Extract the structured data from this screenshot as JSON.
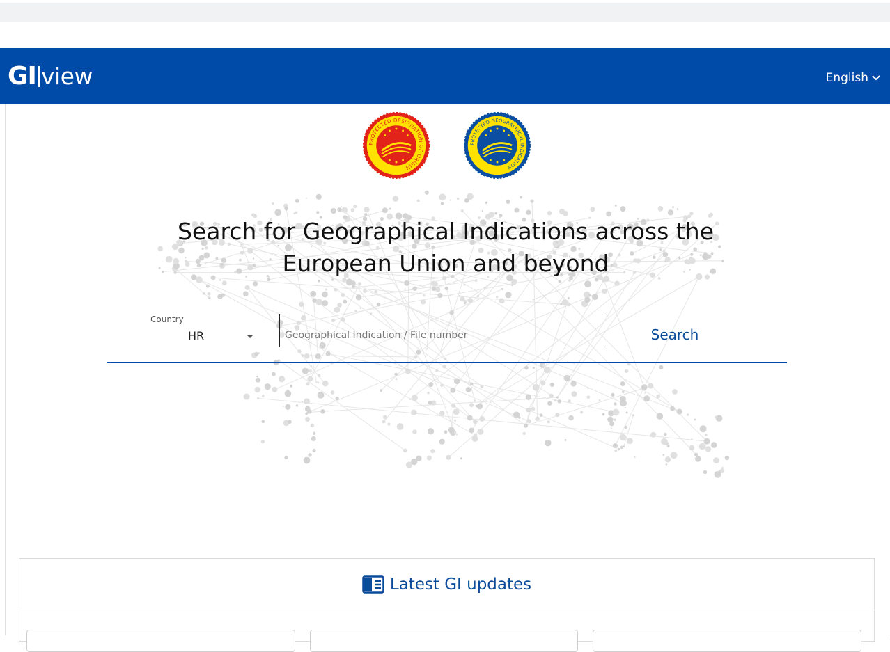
{
  "header": {
    "logo_bold": "GI",
    "logo_light": "view",
    "language": "English"
  },
  "seals": {
    "pdo": {
      "text": "PROTECTED DESIGNATION OF ORIGIN",
      "color": "#e2231a",
      "ring": "#ffe200"
    },
    "pgi": {
      "text": "PROTECTED GEOGRAPHICAL INDICATION",
      "color": "#0b4ea2",
      "ring": "#ffe200"
    }
  },
  "hero": {
    "title_line1": "Search for Geographical Indications across the",
    "title_line2": "European Union and beyond"
  },
  "search": {
    "country_label": "Country",
    "country_value": "HR",
    "input_placeholder": "Geographical Indication / File number",
    "input_value": "",
    "button_label": "Search"
  },
  "updates": {
    "title": "Latest GI updates"
  },
  "colors": {
    "brand": "#004aa8",
    "link": "#0a4b9a"
  }
}
